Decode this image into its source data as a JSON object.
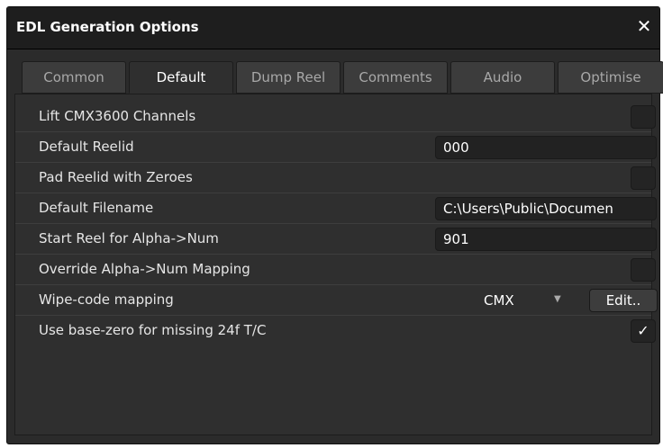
{
  "dialog": {
    "title": "EDL Generation Options",
    "close_label": "✕"
  },
  "tabs": [
    {
      "label": "Common",
      "active": false
    },
    {
      "label": "Default",
      "active": true
    },
    {
      "label": "Dump Reel",
      "active": false
    },
    {
      "label": "Comments",
      "active": false
    },
    {
      "label": "Audio",
      "active": false
    },
    {
      "label": "Optimise",
      "active": false
    }
  ],
  "rows": {
    "lift_cmx": {
      "label": "Lift CMX3600 Channels",
      "checked": false
    },
    "default_reelid": {
      "label": "Default Reelid",
      "value": "000"
    },
    "pad_reelid": {
      "label": "Pad Reelid with Zeroes",
      "checked": false
    },
    "default_filename": {
      "label": "Default Filename",
      "value": "C:\\Users\\Public\\Documen"
    },
    "start_reel": {
      "label": "Start Reel for Alpha->Num",
      "value": "901"
    },
    "override_mapping": {
      "label": "Override Alpha->Num Mapping",
      "checked": false
    },
    "wipe_code": {
      "label": "Wipe-code mapping",
      "value": "CMX",
      "edit_label": "Edit.."
    },
    "base_zero": {
      "label": "Use base-zero for missing 24f T/C",
      "checked": true,
      "check_glyph": "✓"
    }
  },
  "colors": {
    "background": "#2f2f2f",
    "titlebar": "#1e1e1e",
    "text": "#e6e6e6"
  }
}
